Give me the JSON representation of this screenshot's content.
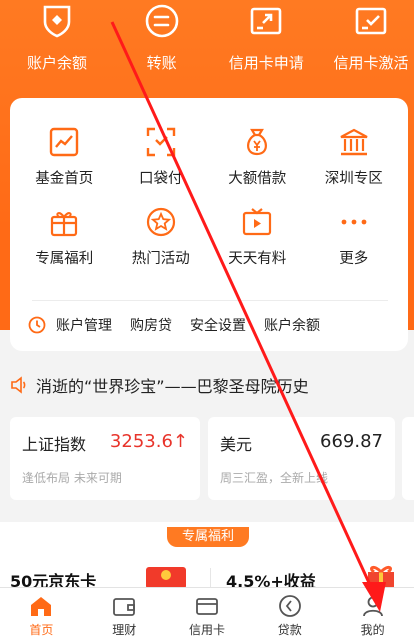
{
  "top_actions": [
    {
      "label": "账户余额",
      "icon": "shield-icon"
    },
    {
      "label": "转账",
      "icon": "transfer-icon"
    },
    {
      "label": "信用卡申请",
      "icon": "card-upload-icon"
    },
    {
      "label": "信用卡激活",
      "icon": "card-check-icon"
    }
  ],
  "services": [
    {
      "label": "基金首页",
      "icon": "chart-icon"
    },
    {
      "label": "口袋付",
      "icon": "scan-icon"
    },
    {
      "label": "大额借款",
      "icon": "money-bag-icon"
    },
    {
      "label": "深圳专区",
      "icon": "bank-building-icon"
    },
    {
      "label": "专属福利",
      "icon": "gift-icon"
    },
    {
      "label": "热门活动",
      "icon": "star-icon"
    },
    {
      "label": "天天有料",
      "icon": "tv-icon"
    },
    {
      "label": "更多",
      "icon": "more-icon"
    }
  ],
  "account_links": [
    "账户管理",
    "购房贷",
    "安全设置",
    "账户余额"
  ],
  "notice": {
    "text": "消逝的“世界珍宝”——巴黎圣母院历史"
  },
  "quotes": [
    {
      "name": "上证指数",
      "value": "3253.6",
      "trend": "↑",
      "sub": "逢低布局 未来可期",
      "value_color": "#e8342b"
    },
    {
      "name": "美元",
      "value": "669.87",
      "trend": "",
      "sub": "周三汇盈，全新上线",
      "value_color": "#222222"
    }
  ],
  "welfare": {
    "tag": "专属福利",
    "left_title": "50元京东卡",
    "right_title": "4.5%+收益"
  },
  "tabs": [
    {
      "label": "首页",
      "icon": "home-icon",
      "active": true
    },
    {
      "label": "理财",
      "icon": "wallet-icon",
      "active": false
    },
    {
      "label": "信用卡",
      "icon": "credit-card-icon",
      "active": false
    },
    {
      "label": "贷款",
      "icon": "loan-icon",
      "active": false
    },
    {
      "label": "我的",
      "icon": "user-icon",
      "active": false
    }
  ],
  "colors": {
    "brand": "#ff6a16",
    "accent": "#e8342b"
  }
}
